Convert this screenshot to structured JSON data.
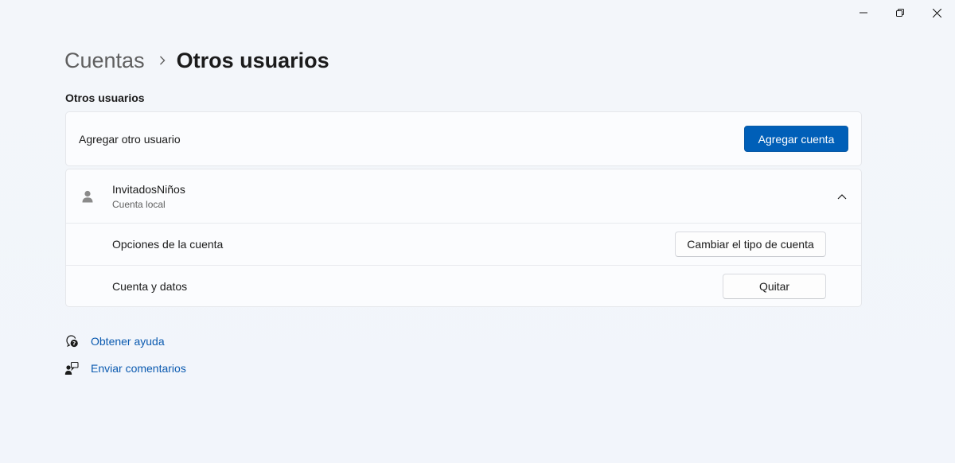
{
  "window": {
    "controls": [
      "minimize-icon",
      "restore-icon",
      "close-icon"
    ]
  },
  "breadcrumb": {
    "parent": "Cuentas",
    "current": "Otros usuarios"
  },
  "section": {
    "title": "Otros usuarios"
  },
  "add_user": {
    "label": "Agregar otro usuario",
    "button": "Agregar cuenta"
  },
  "user": {
    "name": "InvitadosNiños",
    "type": "Cuenta local",
    "rows": [
      {
        "label": "Opciones de la cuenta",
        "button": "Cambiar el tipo de cuenta"
      },
      {
        "label": "Cuenta y datos",
        "button": "Quitar"
      }
    ]
  },
  "links": {
    "help": "Obtener ayuda",
    "feedback": "Enviar comentarios"
  },
  "colors": {
    "accent": "#005fb8",
    "link": "#0b5ab0",
    "background": "#f3f6fb"
  }
}
